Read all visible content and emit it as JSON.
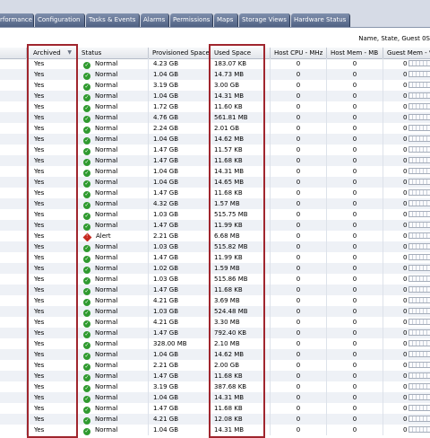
{
  "tabs": [
    "rformance",
    "Configuration",
    "Tasks & Events",
    "Alarms",
    "Permissions",
    "Maps",
    "Storage Views",
    "Hardware Status"
  ],
  "filter_label": "Name, State, Guest 0S",
  "columns": {
    "archived": "Archived",
    "status": "Status",
    "provisioned": "Provisioned Space",
    "used": "Used Space",
    "cpu": "Host CPU - MHz",
    "host_mem": "Host Mem - MB",
    "guest_mem": "Guest Mem - %"
  },
  "colors": {
    "ok": "#2f9a2f",
    "alert": "#c52a20",
    "highlight": "#a0262e",
    "tab": "#5a6b8c"
  },
  "rows": [
    {
      "archived": "Yes",
      "status": "Normal",
      "icon": "ok-icon",
      "provisioned": "4.23 GB",
      "used": "183.07 KB",
      "cpu": "0",
      "host_mem": "0",
      "guest_mem": "0"
    },
    {
      "archived": "Yes",
      "status": "Normal",
      "icon": "ok-icon",
      "provisioned": "1.04 GB",
      "used": "14.73 MB",
      "cpu": "0",
      "host_mem": "0",
      "guest_mem": "0"
    },
    {
      "archived": "Yes",
      "status": "Normal",
      "icon": "ok-icon",
      "provisioned": "3.19 GB",
      "used": "3.00 GB",
      "cpu": "0",
      "host_mem": "0",
      "guest_mem": "0"
    },
    {
      "archived": "Yes",
      "status": "Normal",
      "icon": "ok-icon",
      "provisioned": "1.04 GB",
      "used": "14.31 MB",
      "cpu": "0",
      "host_mem": "0",
      "guest_mem": "0"
    },
    {
      "archived": "Yes",
      "status": "Normal",
      "icon": "ok-icon",
      "provisioned": "1.72 GB",
      "used": "11.60 KB",
      "cpu": "0",
      "host_mem": "0",
      "guest_mem": "0"
    },
    {
      "archived": "Yes",
      "status": "Normal",
      "icon": "ok-icon",
      "provisioned": "4.76 GB",
      "used": "561.81 MB",
      "cpu": "0",
      "host_mem": "0",
      "guest_mem": "0"
    },
    {
      "archived": "Yes",
      "status": "Normal",
      "icon": "ok-icon",
      "provisioned": "2.24 GB",
      "used": "2.01 GB",
      "cpu": "0",
      "host_mem": "0",
      "guest_mem": "0"
    },
    {
      "archived": "Yes",
      "status": "Normal",
      "icon": "ok-icon",
      "provisioned": "1.04 GB",
      "used": "14.62 MB",
      "cpu": "0",
      "host_mem": "0",
      "guest_mem": "0"
    },
    {
      "archived": "Yes",
      "status": "Normal",
      "icon": "ok-icon",
      "provisioned": "1.47 GB",
      "used": "11.57 KB",
      "cpu": "0",
      "host_mem": "0",
      "guest_mem": "0"
    },
    {
      "archived": "Yes",
      "status": "Normal",
      "icon": "ok-icon",
      "provisioned": "1.47 GB",
      "used": "11.68 KB",
      "cpu": "0",
      "host_mem": "0",
      "guest_mem": "0"
    },
    {
      "archived": "Yes",
      "status": "Normal",
      "icon": "ok-icon",
      "provisioned": "1.04 GB",
      "used": "14.31 MB",
      "cpu": "0",
      "host_mem": "0",
      "guest_mem": "0"
    },
    {
      "archived": "Yes",
      "status": "Normal",
      "icon": "ok-icon",
      "provisioned": "1.04 GB",
      "used": "14.65 MB",
      "cpu": "0",
      "host_mem": "0",
      "guest_mem": "0"
    },
    {
      "archived": "Yes",
      "status": "Normal",
      "icon": "ok-icon",
      "provisioned": "1.47 GB",
      "used": "11.68 KB",
      "cpu": "0",
      "host_mem": "0",
      "guest_mem": "0"
    },
    {
      "archived": "Yes",
      "status": "Normal",
      "icon": "ok-icon",
      "provisioned": "4.32 GB",
      "used": "1.57 MB",
      "cpu": "0",
      "host_mem": "0",
      "guest_mem": "0"
    },
    {
      "archived": "Yes",
      "status": "Normal",
      "icon": "ok-icon",
      "provisioned": "1.03 GB",
      "used": "515.75 MB",
      "cpu": "0",
      "host_mem": "0",
      "guest_mem": "0"
    },
    {
      "archived": "Yes",
      "status": "Normal",
      "icon": "ok-icon",
      "provisioned": "1.47 GB",
      "used": "11.99 KB",
      "cpu": "0",
      "host_mem": "0",
      "guest_mem": "0"
    },
    {
      "archived": "Yes",
      "status": "Alert",
      "icon": "alert-icon",
      "provisioned": "2.21 GB",
      "used": "6.68 MB",
      "cpu": "0",
      "host_mem": "0",
      "guest_mem": "0"
    },
    {
      "archived": "Yes",
      "status": "Normal",
      "icon": "ok-icon",
      "provisioned": "1.03 GB",
      "used": "515.82 MB",
      "cpu": "0",
      "host_mem": "0",
      "guest_mem": "0"
    },
    {
      "archived": "Yes",
      "status": "Normal",
      "icon": "ok-icon",
      "provisioned": "1.47 GB",
      "used": "11.99 KB",
      "cpu": "0",
      "host_mem": "0",
      "guest_mem": "0"
    },
    {
      "archived": "Yes",
      "status": "Normal",
      "icon": "ok-icon",
      "provisioned": "1.02 GB",
      "used": "1.59 MB",
      "cpu": "0",
      "host_mem": "0",
      "guest_mem": "0"
    },
    {
      "archived": "Yes",
      "status": "Normal",
      "icon": "ok-icon",
      "provisioned": "1.03 GB",
      "used": "515.86 MB",
      "cpu": "0",
      "host_mem": "0",
      "guest_mem": "0"
    },
    {
      "archived": "Yes",
      "status": "Normal",
      "icon": "ok-icon",
      "provisioned": "1.47 GB",
      "used": "11.68 KB",
      "cpu": "0",
      "host_mem": "0",
      "guest_mem": "0"
    },
    {
      "archived": "Yes",
      "status": "Normal",
      "icon": "ok-icon",
      "provisioned": "4.21 GB",
      "used": "3.69 MB",
      "cpu": "0",
      "host_mem": "0",
      "guest_mem": "0"
    },
    {
      "archived": "Yes",
      "status": "Normal",
      "icon": "ok-icon",
      "provisioned": "1.03 GB",
      "used": "524.48 MB",
      "cpu": "0",
      "host_mem": "0",
      "guest_mem": "0"
    },
    {
      "archived": "Yes",
      "status": "Normal",
      "icon": "ok-icon",
      "provisioned": "4.21 GB",
      "used": "3.30 MB",
      "cpu": "0",
      "host_mem": "0",
      "guest_mem": "0"
    },
    {
      "archived": "Yes",
      "status": "Normal",
      "icon": "ok-icon",
      "provisioned": "1.47 GB",
      "used": "792.40 KB",
      "cpu": "0",
      "host_mem": "0",
      "guest_mem": "0"
    },
    {
      "archived": "Yes",
      "status": "Normal",
      "icon": "ok-icon",
      "provisioned": "328.00 MB",
      "used": "2.10 MB",
      "cpu": "0",
      "host_mem": "0",
      "guest_mem": "0"
    },
    {
      "archived": "Yes",
      "status": "Normal",
      "icon": "ok-icon",
      "provisioned": "1.04 GB",
      "used": "14.62 MB",
      "cpu": "0",
      "host_mem": "0",
      "guest_mem": "0"
    },
    {
      "archived": "Yes",
      "status": "Normal",
      "icon": "ok-icon",
      "provisioned": "2.21 GB",
      "used": "2.00 GB",
      "cpu": "0",
      "host_mem": "0",
      "guest_mem": "0"
    },
    {
      "archived": "Yes",
      "status": "Normal",
      "icon": "ok-icon",
      "provisioned": "1.47 GB",
      "used": "11.68 KB",
      "cpu": "0",
      "host_mem": "0",
      "guest_mem": "0"
    },
    {
      "archived": "Yes",
      "status": "Normal",
      "icon": "ok-icon",
      "provisioned": "3.19 GB",
      "used": "387.68 KB",
      "cpu": "0",
      "host_mem": "0",
      "guest_mem": "0"
    },
    {
      "archived": "Yes",
      "status": "Normal",
      "icon": "ok-icon",
      "provisioned": "1.04 GB",
      "used": "14.31 MB",
      "cpu": "0",
      "host_mem": "0",
      "guest_mem": "0"
    },
    {
      "archived": "Yes",
      "status": "Normal",
      "icon": "ok-icon",
      "provisioned": "1.47 GB",
      "used": "11.68 KB",
      "cpu": "0",
      "host_mem": "0",
      "guest_mem": "0"
    },
    {
      "archived": "Yes",
      "status": "Normal",
      "icon": "ok-icon",
      "provisioned": "4.21 GB",
      "used": "12.08 KB",
      "cpu": "0",
      "host_mem": "0",
      "guest_mem": "0"
    },
    {
      "archived": "Yes",
      "status": "Normal",
      "icon": "ok-icon",
      "provisioned": "1.04 GB",
      "used": "14.31 MB",
      "cpu": "0",
      "host_mem": "0",
      "guest_mem": "0"
    }
  ]
}
